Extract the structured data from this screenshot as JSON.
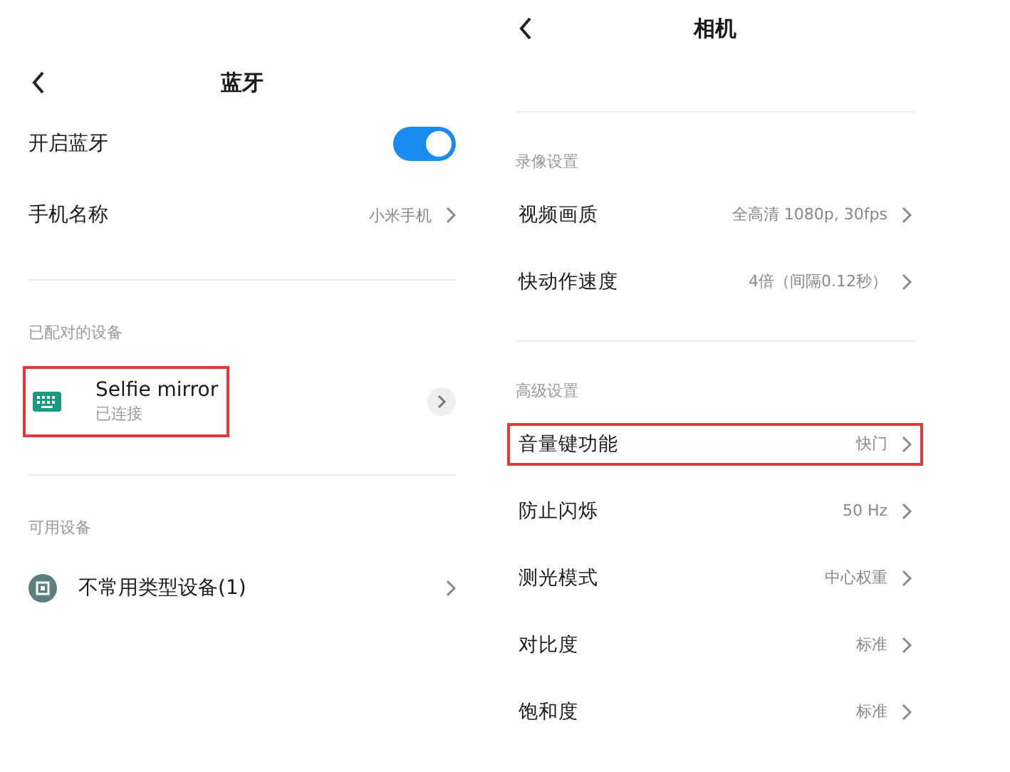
{
  "bluetooth_screen": {
    "title": "蓝牙",
    "settings": [
      {
        "kind": "toggle",
        "label": "开启蓝牙",
        "on": true
      },
      {
        "kind": "link",
        "label": "手机名称",
        "value": "小米手机"
      }
    ],
    "sections": [
      {
        "title": "已配对的设备",
        "devices": [
          {
            "kind": "paired",
            "name": "Selfie mirror",
            "status": "已连接",
            "highlighted": true
          }
        ]
      },
      {
        "title": "可用设备",
        "devices": [
          {
            "kind": "available",
            "name": "不常用类型设备(1)",
            "highlighted": false
          }
        ]
      }
    ]
  },
  "camera_screen": {
    "title": "相机",
    "sections": [
      {
        "title": "录像设置",
        "items": [
          {
            "label": "视频画质",
            "value": "全高清 1080p, 30fps",
            "highlighted": false
          },
          {
            "label": "快动作速度",
            "value": "4倍（间隔0.12秒）",
            "highlighted": false
          }
        ]
      },
      {
        "title": "高级设置",
        "items": [
          {
            "label": "音量键功能",
            "value": "快门",
            "highlighted": true
          },
          {
            "label": "防止闪烁",
            "value": "50 Hz",
            "highlighted": false
          },
          {
            "label": "测光模式",
            "value": "中心权重",
            "highlighted": false
          },
          {
            "label": "对比度",
            "value": "标准",
            "highlighted": false
          },
          {
            "label": "饱和度",
            "value": "标准",
            "highlighted": false
          }
        ]
      }
    ]
  }
}
